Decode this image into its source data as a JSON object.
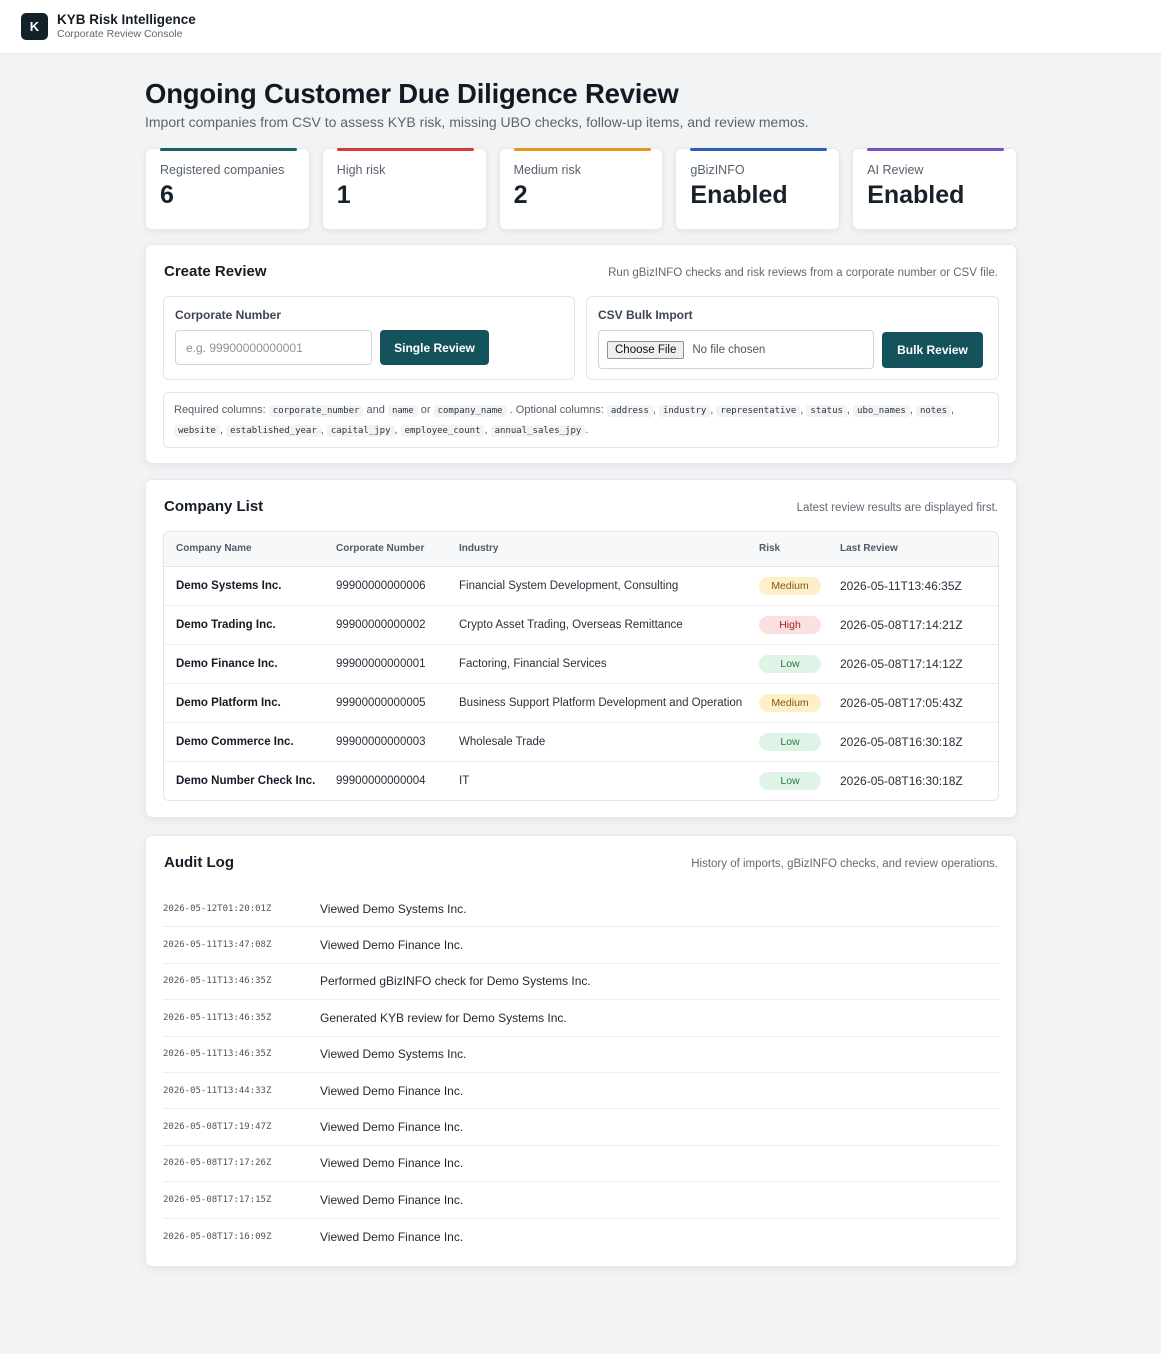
{
  "header": {
    "logo_letter": "K",
    "title": "KYB Risk Intelligence",
    "subtitle": "Corporate Review Console"
  },
  "page": {
    "title": "Ongoing Customer Due Diligence Review",
    "subtitle": "Import companies from CSV to assess KYB risk, missing UBO checks, follow-up items, and review memos."
  },
  "stats": [
    {
      "label": "Registered companies",
      "value": "6",
      "color": "#1c5e66"
    },
    {
      "label": "High risk",
      "value": "1",
      "color": "#d63a3a"
    },
    {
      "label": "Medium risk",
      "value": "2",
      "color": "#e7951f"
    },
    {
      "label": "gBizINFO",
      "value": "Enabled",
      "color": "#2e5fb8"
    },
    {
      "label": "AI Review",
      "value": "Enabled",
      "color": "#7b4fc2"
    }
  ],
  "create_review": {
    "title": "Create Review",
    "note": "Run gBizINFO checks and risk reviews from a corporate number or CSV file.",
    "single": {
      "label": "Corporate Number",
      "placeholder": "e.g. 99900000000001",
      "button": "Single Review"
    },
    "bulk": {
      "label": "CSV Bulk Import",
      "file_button": "Choose File",
      "file_status": "No file chosen",
      "button": "Bulk Review"
    },
    "columns_note": {
      "required_label": "Required columns:",
      "and": "and",
      "or": "or",
      "optional_label": ". Optional columns:",
      "required": [
        "corporate_number",
        "name",
        "company_name"
      ],
      "optional": [
        "address",
        "industry",
        "representative",
        "status",
        "ubo_names",
        "notes",
        "website",
        "established_year",
        "capital_jpy",
        "employee_count",
        "annual_sales_jpy"
      ]
    }
  },
  "company_list": {
    "title": "Company List",
    "note": "Latest review results are displayed first.",
    "columns": [
      "Company Name",
      "Corporate Number",
      "Industry",
      "Risk",
      "Last Review"
    ],
    "rows": [
      {
        "name": "Demo Systems Inc.",
        "number": "99900000000006",
        "industry": "Financial System Development, Consulting",
        "risk": "Medium",
        "risk_level": "medium",
        "last_review": "2026-05-11T13:46:35Z"
      },
      {
        "name": "Demo Trading Inc.",
        "number": "99900000000002",
        "industry": "Crypto Asset Trading, Overseas Remittance",
        "risk": "High",
        "risk_level": "high",
        "last_review": "2026-05-08T17:14:21Z"
      },
      {
        "name": "Demo Finance Inc.",
        "number": "99900000000001",
        "industry": "Factoring, Financial Services",
        "risk": "Low",
        "risk_level": "low",
        "last_review": "2026-05-08T17:14:12Z"
      },
      {
        "name": "Demo Platform Inc.",
        "number": "99900000000005",
        "industry": "Business Support Platform Development and Operation",
        "risk": "Medium",
        "risk_level": "medium",
        "last_review": "2026-05-08T17:05:43Z"
      },
      {
        "name": "Demo Commerce Inc.",
        "number": "99900000000003",
        "industry": "Wholesale Trade",
        "risk": "Low",
        "risk_level": "low",
        "last_review": "2026-05-08T16:30:18Z"
      },
      {
        "name": "Demo Number Check Inc.",
        "number": "99900000000004",
        "industry": "IT",
        "risk": "Low",
        "risk_level": "low",
        "last_review": "2026-05-08T16:30:18Z"
      }
    ]
  },
  "audit_log": {
    "title": "Audit Log",
    "note": "History of imports, gBizINFO checks, and review operations.",
    "entries": [
      {
        "ts": "2026-05-12T01:20:01Z",
        "msg": "Viewed Demo Systems Inc."
      },
      {
        "ts": "2026-05-11T13:47:08Z",
        "msg": "Viewed Demo Finance Inc."
      },
      {
        "ts": "2026-05-11T13:46:35Z",
        "msg": "Performed gBizINFO check for Demo Systems Inc."
      },
      {
        "ts": "2026-05-11T13:46:35Z",
        "msg": "Generated KYB review for Demo Systems Inc."
      },
      {
        "ts": "2026-05-11T13:46:35Z",
        "msg": "Viewed Demo Systems Inc."
      },
      {
        "ts": "2026-05-11T13:44:33Z",
        "msg": "Viewed Demo Finance Inc."
      },
      {
        "ts": "2026-05-08T17:19:47Z",
        "msg": "Viewed Demo Finance Inc."
      },
      {
        "ts": "2026-05-08T17:17:26Z",
        "msg": "Viewed Demo Finance Inc."
      },
      {
        "ts": "2026-05-08T17:17:15Z",
        "msg": "Viewed Demo Finance Inc."
      },
      {
        "ts": "2026-05-08T17:16:09Z",
        "msg": "Viewed Demo Finance Inc."
      }
    ]
  }
}
